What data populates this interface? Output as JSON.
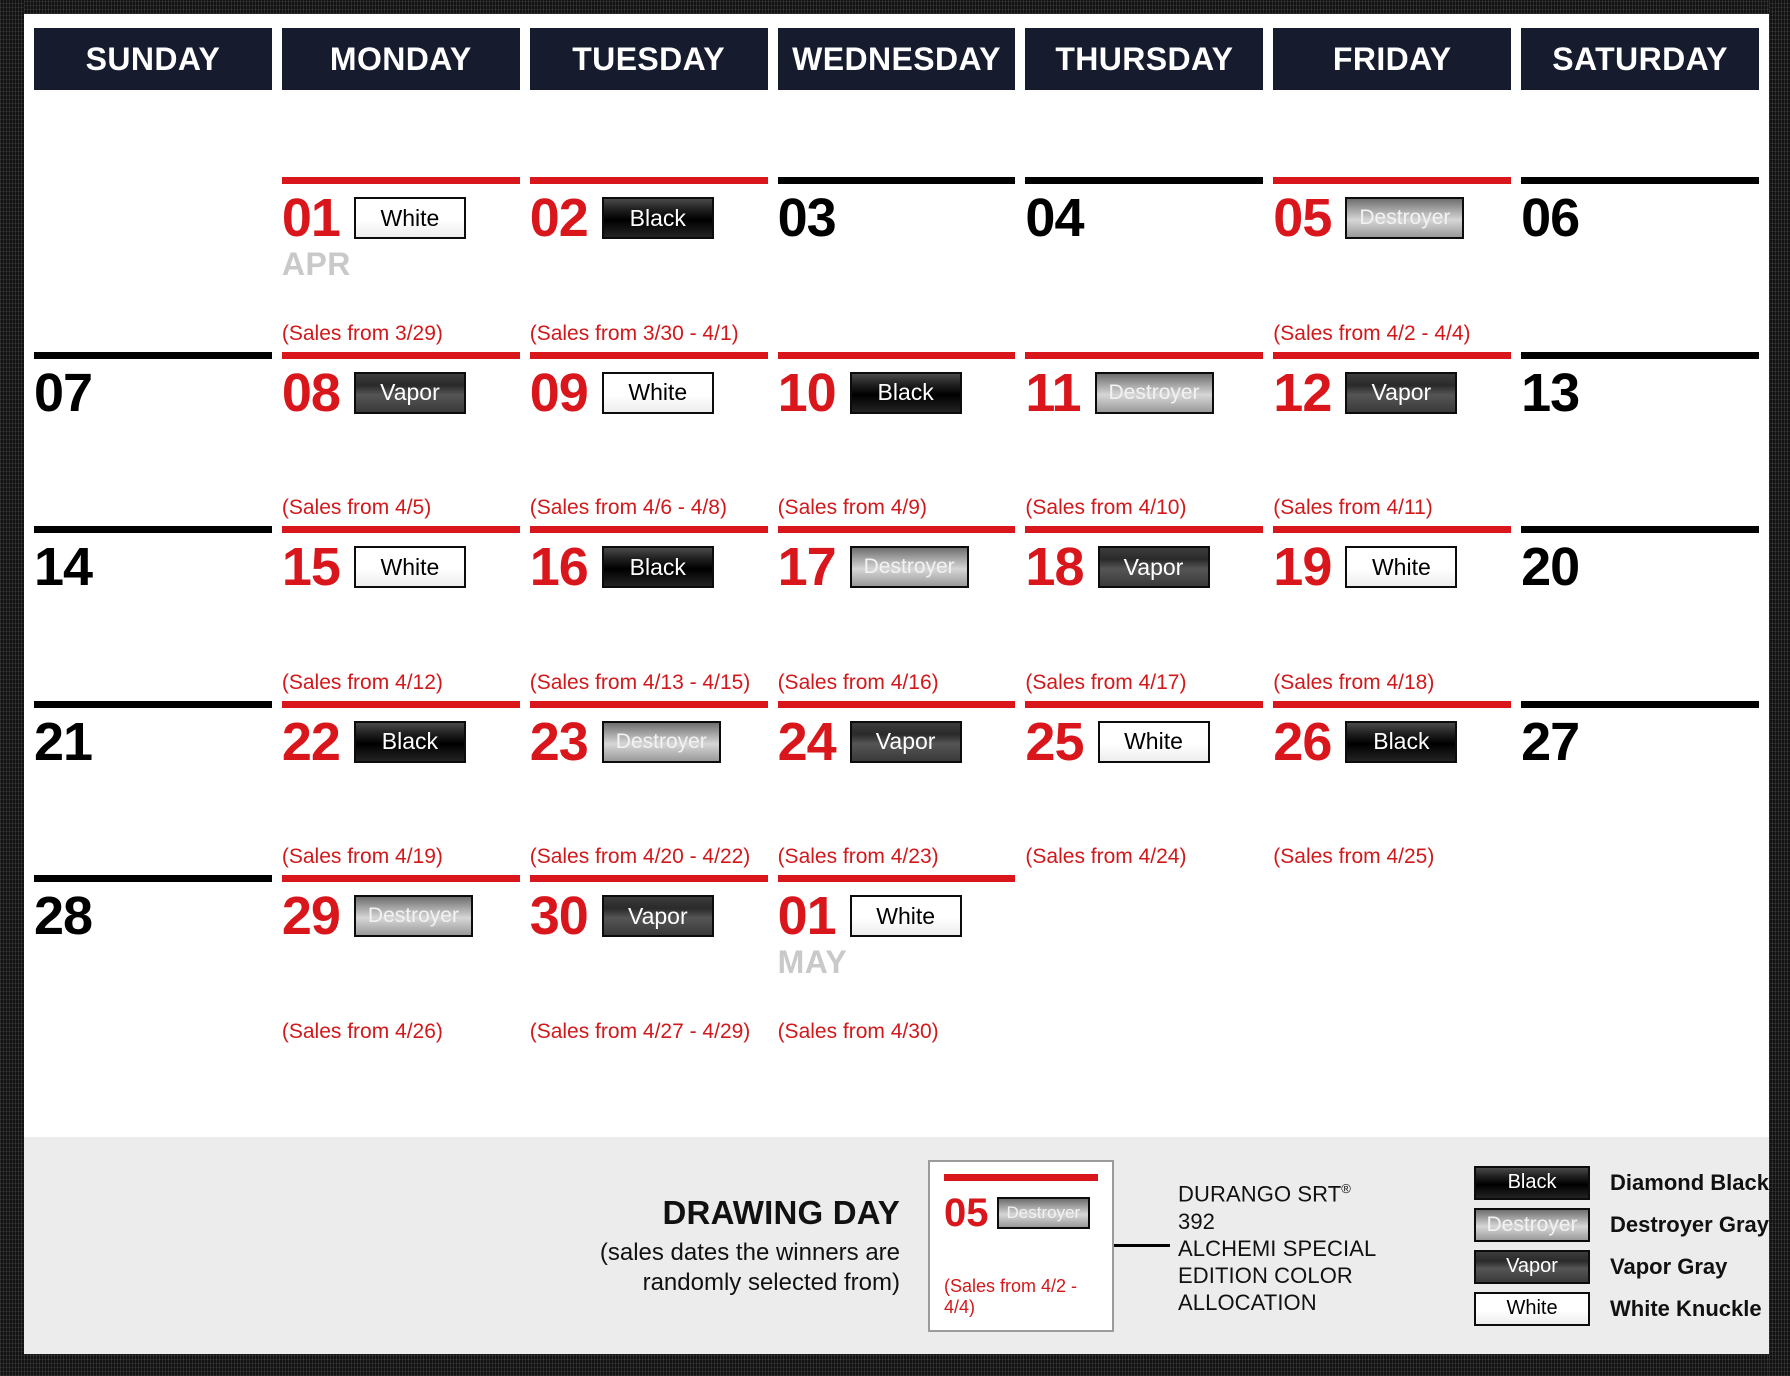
{
  "weekdays": [
    "SUNDAY",
    "MONDAY",
    "TUESDAY",
    "WEDNESDAY",
    "THURSDAY",
    "FRIDAY",
    "SATURDAY"
  ],
  "colors": {
    "red": "#d8161c",
    "header_navy": "#161b2e",
    "legend_bg": "#ececec",
    "month_tag_gray": "#c9c9c9"
  },
  "weeks": [
    [
      {
        "empty": true
      },
      {
        "day": "01",
        "red": true,
        "chip": "White",
        "chip_kind": "white",
        "month_tag": "APR"
      },
      {
        "day": "02",
        "red": true,
        "chip": "Black",
        "chip_kind": "black"
      },
      {
        "day": "03",
        "red": false
      },
      {
        "day": "04",
        "red": false
      },
      {
        "day": "05",
        "red": true,
        "chip": "Destroyer",
        "chip_kind": "destroyer"
      },
      {
        "day": "06",
        "red": false
      }
    ],
    [
      {
        "day": "07",
        "red": false
      },
      {
        "day": "08",
        "red": true,
        "chip": "Vapor",
        "chip_kind": "vapor",
        "note": "(Sales from 3/29)"
      },
      {
        "day": "09",
        "red": true,
        "chip": "White",
        "chip_kind": "white",
        "note": "(Sales from 3/30 - 4/1)"
      },
      {
        "day": "10",
        "red": true,
        "chip": "Black",
        "chip_kind": "black"
      },
      {
        "day": "11",
        "red": true,
        "chip": "Destroyer",
        "chip_kind": "destroyer"
      },
      {
        "day": "12",
        "red": true,
        "chip": "Vapor",
        "chip_kind": "vapor",
        "note": "(Sales from 4/2 - 4/4)"
      },
      {
        "day": "13",
        "red": false
      }
    ],
    [
      {
        "day": "14",
        "red": false
      },
      {
        "day": "15",
        "red": true,
        "chip": "White",
        "chip_kind": "white",
        "note": "(Sales from 4/5)"
      },
      {
        "day": "16",
        "red": true,
        "chip": "Black",
        "chip_kind": "black",
        "note": "(Sales from 4/6 - 4/8)"
      },
      {
        "day": "17",
        "red": true,
        "chip": "Destroyer",
        "chip_kind": "destroyer",
        "note": "(Sales from 4/9)"
      },
      {
        "day": "18",
        "red": true,
        "chip": "Vapor",
        "chip_kind": "vapor",
        "note": "(Sales from 4/10)"
      },
      {
        "day": "19",
        "red": true,
        "chip": "White",
        "chip_kind": "white",
        "note": "(Sales from 4/11)"
      },
      {
        "day": "20",
        "red": false
      }
    ],
    [
      {
        "day": "21",
        "red": false
      },
      {
        "day": "22",
        "red": true,
        "chip": "Black",
        "chip_kind": "black",
        "note": "(Sales from 4/12)"
      },
      {
        "day": "23",
        "red": true,
        "chip": "Destroyer",
        "chip_kind": "destroyer",
        "note": "(Sales from 4/13 - 4/15)"
      },
      {
        "day": "24",
        "red": true,
        "chip": "Vapor",
        "chip_kind": "vapor",
        "note": "(Sales from 4/16)"
      },
      {
        "day": "25",
        "red": true,
        "chip": "White",
        "chip_kind": "white",
        "note": "(Sales from 4/17)"
      },
      {
        "day": "26",
        "red": true,
        "chip": "Black",
        "chip_kind": "black",
        "note": "(Sales from 4/18)"
      },
      {
        "day": "27",
        "red": false
      }
    ],
    [
      {
        "day": "28",
        "red": false
      },
      {
        "day": "29",
        "red": true,
        "chip": "Destroyer",
        "chip_kind": "destroyer",
        "note": "(Sales from 4/19)"
      },
      {
        "day": "30",
        "red": true,
        "chip": "Vapor",
        "chip_kind": "vapor",
        "note": "(Sales from 4/20 - 4/22)"
      },
      {
        "day": "01",
        "red": true,
        "chip": "White",
        "chip_kind": "white",
        "note": "(Sales from 4/23)",
        "month_tag": "MAY"
      },
      {
        "empty": true,
        "note": "(Sales from 4/24)"
      },
      {
        "empty": true,
        "note": "(Sales from 4/25)"
      },
      {
        "empty": true
      }
    ],
    [
      {
        "empty": true
      },
      {
        "empty": true,
        "note": "(Sales from 4/26)"
      },
      {
        "empty": true,
        "note": "(Sales from 4/27 - 4/29)"
      },
      {
        "empty": true,
        "note": "(Sales from 4/30)"
      },
      {
        "empty": true
      },
      {
        "empty": true
      },
      {
        "empty": true
      }
    ]
  ],
  "legend": {
    "drawing_day_title": "DRAWING DAY",
    "drawing_day_sub_line1": "(sales dates the winners are",
    "drawing_day_sub_line2": "randomly selected from)",
    "sample": {
      "day": "05",
      "chip": "Destroyer",
      "note": "(Sales from 4/2 - 4/4)"
    },
    "callout_line1": "DURANGO SRT",
    "callout_sup": "®",
    "callout_line1b": " 392",
    "callout_line2": "ALCHEMI SPECIAL",
    "callout_line3": "EDITION COLOR",
    "callout_line4": "ALLOCATION",
    "swatches": [
      {
        "chip": "Black",
        "kind": "black",
        "label": "Diamond Black"
      },
      {
        "chip": "Destroyer",
        "kind": "destroyer",
        "label": "Destroyer Gray"
      },
      {
        "chip": "Vapor",
        "kind": "vapor",
        "label": "Vapor Gray"
      },
      {
        "chip": "White",
        "kind": "white",
        "label": "White Knuckle"
      }
    ]
  }
}
